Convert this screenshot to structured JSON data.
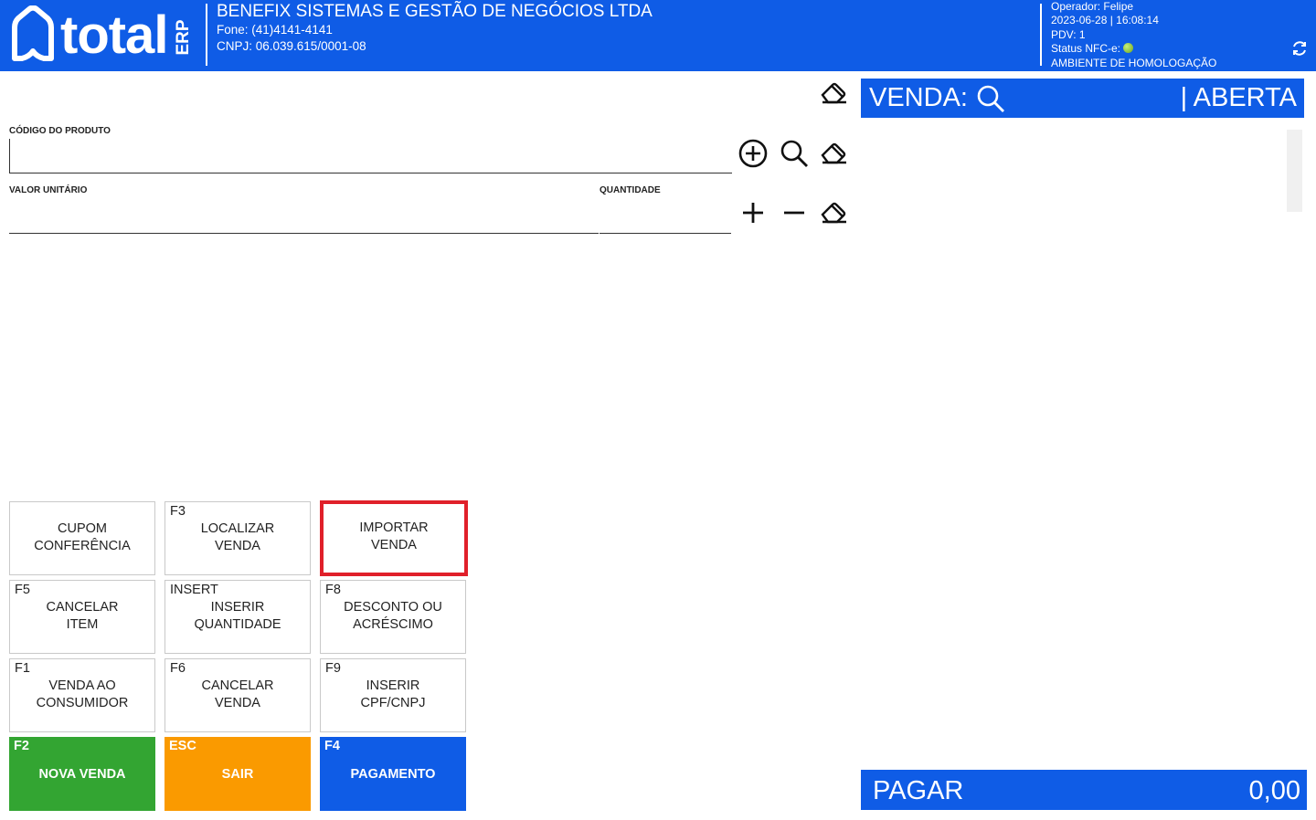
{
  "header": {
    "brand": "total",
    "brand_suffix": "ERP",
    "company_name": "BENEFIX SISTEMAS E GESTÃO DE NEGÓCIOS LTDA",
    "phone": "Fone: (41)4141-4141",
    "cnpj": "CNPJ: 06.039.615/0001-08",
    "operator": "Operador: Felipe",
    "datetime": "2023-06-28 | 16:08:14",
    "pdv": "PDV: 1",
    "nfce_status_label": "Status NFC-e:",
    "nfce_status_color": "#7cc62a",
    "environment": "AMBIENTE DE HOMOLOGAÇÃO",
    "accent_color": "#0f5ce6"
  },
  "form": {
    "product_code_label": "CÓDIGO DO PRODUTO",
    "product_code_value": "",
    "unit_value_label": "VALOR UNITÁRIO",
    "unit_value_value": "",
    "quantity_label": "QUANTIDADE",
    "quantity_value": ""
  },
  "sale": {
    "label": "VENDA:",
    "state": "| ABERTA",
    "pay_label": "PAGAR",
    "pay_total": "0,00"
  },
  "function_keys": [
    {
      "key": "",
      "label": "CUPOM\nCONFERÊNCIA"
    },
    {
      "key": "F3",
      "label": "LOCALIZAR\nVENDA"
    },
    {
      "key": "",
      "label": "IMPORTAR\nVENDA"
    },
    {
      "key": "F5",
      "label": "CANCELAR\nITEM"
    },
    {
      "key": "INSERT",
      "label": "INSERIR\nQUANTIDADE"
    },
    {
      "key": "F8",
      "label": "DESCONTO OU\nACRÉSCIMO"
    },
    {
      "key": "F1",
      "label": "VENDA AO\nCONSUMIDOR"
    },
    {
      "key": "F6",
      "label": "CANCELAR\nVENDA"
    },
    {
      "key": "F9",
      "label": "INSERIR\nCPF/CNPJ"
    },
    {
      "key": "F2",
      "label": "NOVA VENDA",
      "color": "#33a532"
    },
    {
      "key": "ESC",
      "label": "SAIR",
      "color": "#fa9a00"
    },
    {
      "key": "F4",
      "label": "PAGAMENTO",
      "color": "#0f5ce6"
    }
  ],
  "icons": {
    "eraser": "eraser-icon",
    "add_circle": "add-circle-icon",
    "search": "search-icon",
    "plus": "plus-icon",
    "minus": "minus-icon",
    "sync": "sync-icon"
  }
}
